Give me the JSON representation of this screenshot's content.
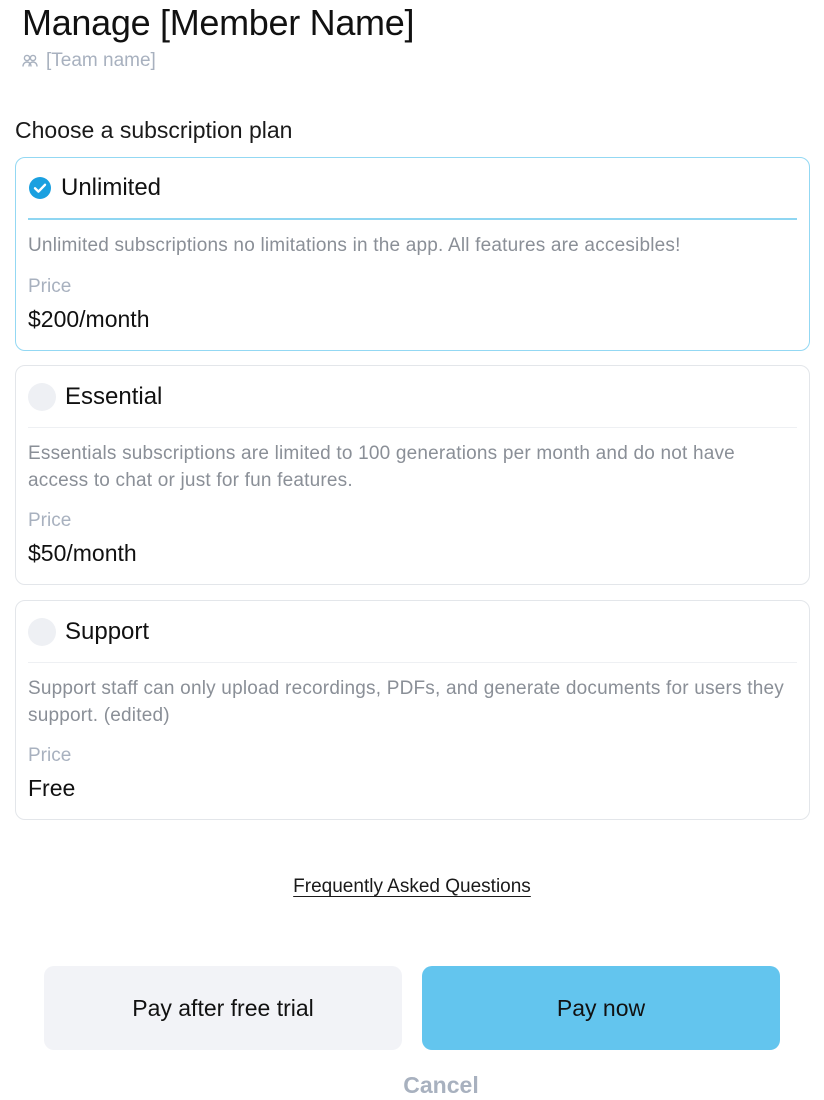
{
  "header": {
    "title": "Manage [Member Name]",
    "team_name": "[Team name]",
    "team_icon": "team-icon"
  },
  "section": {
    "label": "Choose a subscription plan"
  },
  "plans": [
    {
      "name": "Unlimited",
      "selected": true,
      "description": "Unlimited subscriptions no limitations in the app.  All features are accesibles!",
      "price_label": "Price",
      "price": "$200/month"
    },
    {
      "name": "Essential",
      "selected": false,
      "description": "Essentials subscriptions are limited to 100 generations per month and do not have access to chat or just for fun features.",
      "price_label": "Price",
      "price": "$50/month"
    },
    {
      "name": "Support",
      "selected": false,
      "description": "Support staff can only upload recordings, PDFs, and generate documents for users they support. (edited)",
      "price_label": "Price",
      "price": "Free"
    }
  ],
  "links": {
    "faq": "Frequently Asked Questions"
  },
  "actions": {
    "secondary_label": "Pay after free trial",
    "primary_label": "Pay now",
    "cancel_label": "Cancel"
  },
  "colors": {
    "accent": "#63c5ee",
    "check": "#1aa0e0",
    "selected_border": "#93d8f3"
  }
}
